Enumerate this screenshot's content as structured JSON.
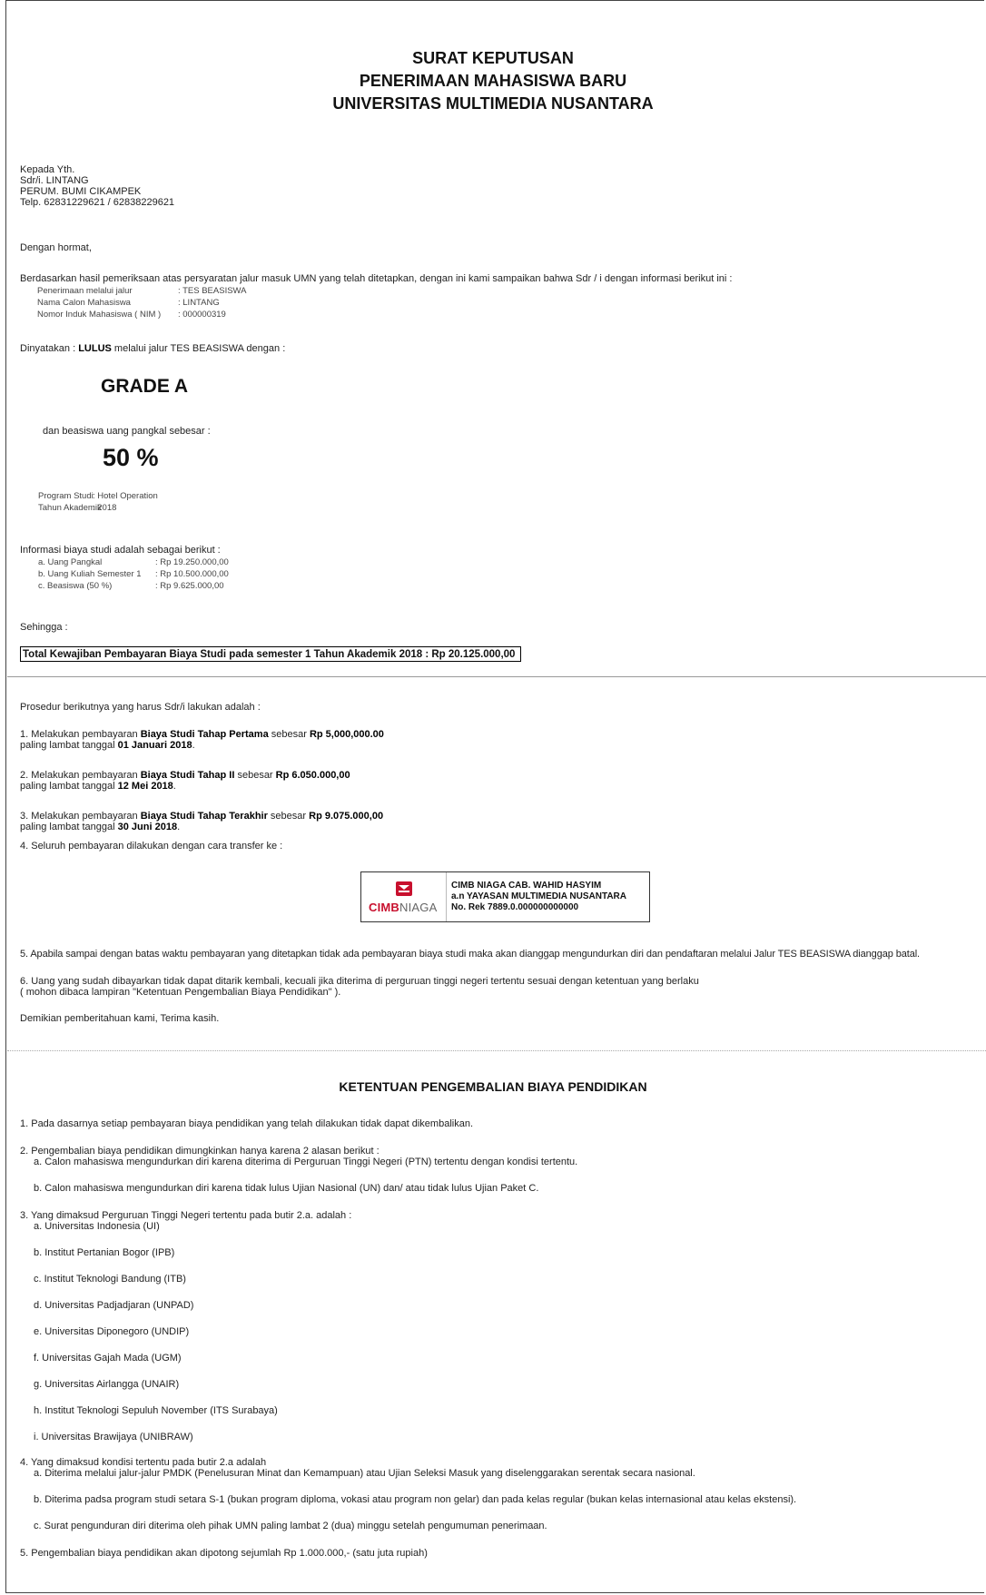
{
  "header": {
    "line1": "SURAT KEPUTUSAN",
    "line2": "PENERIMAAN MAHASISWA BARU",
    "line3": "UNIVERSITAS MULTIMEDIA NUSANTARA"
  },
  "recipient": {
    "to": "Kepada Yth.",
    "name": "Sdr/i. LINTANG",
    "address": "PERUM. BUMI CIKAMPEK",
    "phone": "Telp. 62831229621 / 62838229621"
  },
  "greeting": "Dengan hormat,",
  "intro": "Berdasarkan hasil pemeriksaan atas persyaratan jalur masuk UMN yang telah ditetapkan, dengan ini kami sampaikan bahwa Sdr / i dengan informasi berikut ini :",
  "applicant": [
    {
      "label": "Penerimaan melalui jalur",
      "value": ": TES BEASISWA"
    },
    {
      "label": "Nama Calon Mahasiswa",
      "value": ": LINTANG"
    },
    {
      "label": "Nomor Induk Mahasiswa ( NIM )",
      "value": ": 000000319"
    }
  ],
  "result": {
    "prefix": "Dinyatakan : ",
    "status": "LULUS",
    "suffix": " melalui jalur TES BEASISWA dengan :",
    "grade": "GRADE A",
    "scholarship_label": "dan beasiswa uang pangkal sebesar :",
    "scholarship_pct": "50 %"
  },
  "program": [
    {
      "label": "Program Studi",
      "value": ": Hotel Operation"
    },
    {
      "label": "Tahun Akademik",
      "value": ": 2018"
    }
  ],
  "fees": {
    "heading": "Informasi biaya studi adalah sebagai berikut :",
    "items": [
      {
        "label": "a. Uang Pangkal",
        "value": ": Rp 19.250.000,00"
      },
      {
        "label": "b. Uang Kuliah Semester 1",
        "value": ": Rp 10.500.000,00"
      },
      {
        "label": "c. Beasiswa (50 %)",
        "value": ": Rp 9.625.000,00"
      }
    ],
    "therefore": "Sehingga :",
    "total": "Total Kewajiban Pembayaran Biaya Studi pada semester 1 Tahun Akademik 2018 : Rp 20.125.000,00"
  },
  "procedure": {
    "heading": "Prosedur berikutnya yang harus Sdr/i lakukan adalah :",
    "step1": {
      "pre": "1. Melakukan pembayaran ",
      "b1": "Biaya Studi Tahap Pertama",
      "mid": " sebesar ",
      "b2": "Rp 5,000,000.00",
      "line2pre": "paling lambat tanggal ",
      "date": "01 Januari 2018",
      "end": "."
    },
    "step2": {
      "pre": "2. Melakukan pembayaran ",
      "b1": "Biaya Studi Tahap II",
      "mid": " sebesar ",
      "b2": "Rp 6.050.000,00",
      "line2pre": "paling lambat tanggal ",
      "date": "12 Mei 2018",
      "end": "."
    },
    "step3": {
      "pre": "3. Melakukan pembayaran ",
      "b1": "Biaya Studi Tahap Terakhir",
      "mid": " sebesar ",
      "b2": "Rp 9.075.000,00",
      "line2pre": "paling lambat tanggal ",
      "date": "30 Juni 2018",
      "end": "."
    },
    "step4": "4. Seluruh pembayaran dilakukan dengan cara transfer ke :",
    "bank": {
      "logo_left": "CIMB",
      "logo_right": "NIAGA",
      "line1": "CIMB NIAGA CAB. WAHID HASYIM",
      "line2": "a.n YAYASAN MULTIMEDIA NUSANTARA",
      "line3": "No. Rek 7889.0.000000000000"
    },
    "step5": "5. Apabila sampai dengan batas waktu pembayaran yang ditetapkan tidak ada pembayaran biaya studi maka akan dianggap mengundurkan diri dan pendaftaran melalui Jalur TES BEASISWA dianggap batal.",
    "step6_line1": "6. Uang yang sudah dibayarkan tidak dapat ditarik kembali, kecuali jika diterima di perguruan tinggi negeri tertentu sesuai dengan ketentuan yang berlaku",
    "step6_line2": "( mohon dibaca lampiran \"Ketentuan Pengembalian Biaya Pendidikan\" ).",
    "closing": "Demikian pemberitahuan kami, Terima kasih."
  },
  "refund": {
    "title": "KETENTUAN PENGEMBALIAN BIAYA PENDIDIKAN",
    "p1": "1. Pada dasarnya setiap pembayaran biaya pendidikan yang telah dilakukan tidak dapat dikembalikan.",
    "p2": "2. Pengembalian biaya pendidikan dimungkinkan hanya karena 2 alasan berikut :",
    "p2a": "a. Calon mahasiswa mengundurkan diri karena diterima di Perguruan Tinggi Negeri (PTN) tertentu dengan kondisi tertentu.",
    "p2b": "b. Calon mahasiswa mengundurkan diri karena tidak lulus Ujian Nasional (UN) dan/ atau tidak lulus Ujian Paket C.",
    "p3": "3. Yang dimaksud Perguruan Tinggi Negeri tertentu pada butir 2.a. adalah :",
    "universities": [
      "a. Universitas Indonesia (UI)",
      "b. Institut Pertanian Bogor (IPB)",
      "c. Institut Teknologi Bandung (ITB)",
      "d. Universitas Padjadjaran (UNPAD)",
      "e. Universitas Diponegoro (UNDIP)",
      "f. Universitas Gajah Mada (UGM)",
      "g. Universitas Airlangga (UNAIR)",
      "h. Institut Teknologi Sepuluh November (ITS Surabaya)",
      "i. Universitas Brawijaya (UNIBRAW)"
    ],
    "p4": "4. Yang dimaksud kondisi tertentu pada butir 2.a adalah",
    "p4a": "a. Diterima melalui jalur-jalur PMDK (Penelusuran Minat dan Kemampuan) atau Ujian Seleksi Masuk yang diselenggarakan serentak secara nasional.",
    "p4b": "b. Diterima padsa program studi setara S-1 (bukan program diploma, vokasi atau program non gelar) dan pada kelas regular (bukan kelas internasional atau kelas ekstensi).",
    "p4c": "c. Surat pengunduran diri diterima oleh pihak UMN paling lambat 2 (dua) minggu setelah pengumuman penerimaan.",
    "p5": "5. Pengembalian biaya pendidikan akan dipotong sejumlah Rp 1.000.000,- (satu juta rupiah)"
  }
}
